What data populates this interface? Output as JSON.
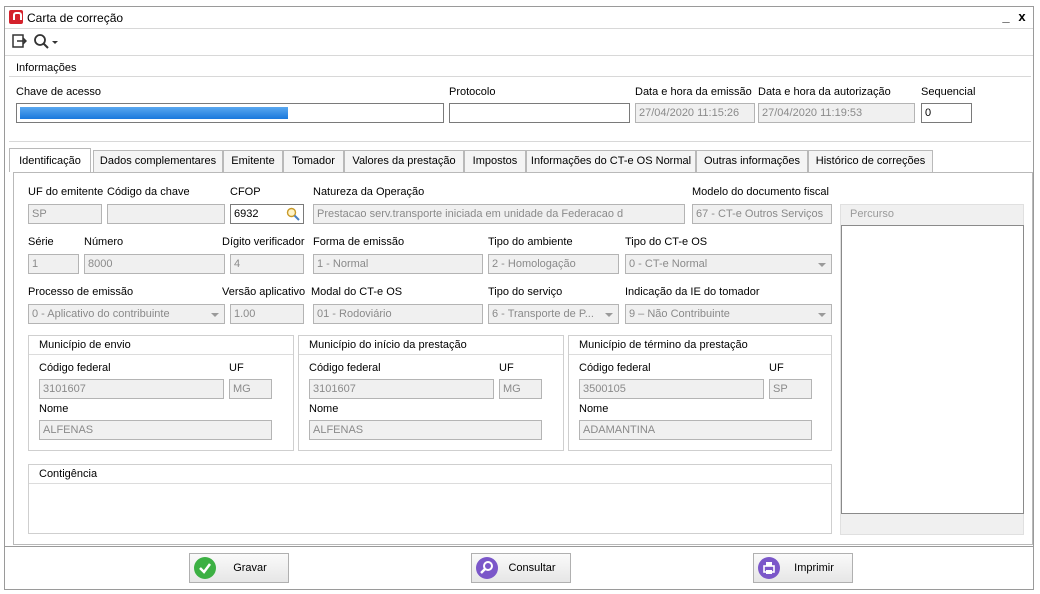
{
  "window": {
    "title": "Carta de correção",
    "minimize": "_",
    "close": "x"
  },
  "toolbar": {
    "exit_icon": "exit-icon",
    "search_icon": "magnifier-icon"
  },
  "info": {
    "section": "Informações",
    "chave_label": "Chave de acesso",
    "chave_progress": 0.63,
    "protocolo_label": "Protocolo",
    "protocolo_value": "",
    "emissao_label": "Data e hora da emissão",
    "emissao_value": "27/04/2020 11:15:26",
    "autorizacao_label": "Data e hora da autorização",
    "autorizacao_value": "27/04/2020 11:19:53",
    "sequencial_label": "Sequencial",
    "sequencial_value": "0"
  },
  "tabs": [
    "Identificação",
    "Dados complementares",
    "Emitente",
    "Tomador",
    "Valores da prestação",
    "Impostos",
    "Informações do CT-e OS Normal",
    "Outras informações",
    "Histórico de correções"
  ],
  "ident": {
    "uf_emitente_label": "UF do emitente",
    "uf_emitente": "SP",
    "codigo_chave_label": "Código da chave",
    "codigo_chave": "",
    "cfop_label": "CFOP",
    "cfop": "6932",
    "natureza_label": "Natureza da Operação",
    "natureza": "Prestacao serv.transporte iniciada em unidade da Federacao d",
    "modelo_label": "Modelo do documento fiscal",
    "modelo": "67 - CT-e Outros Serviços",
    "serie_label": "Série",
    "serie": "1",
    "numero_label": "Número",
    "numero": "8000",
    "digito_label": "Dígito verificador",
    "digito": "4",
    "forma_label": "Forma de emissão",
    "forma": "1 - Normal",
    "ambiente_label": "Tipo do ambiente",
    "ambiente": "2 - Homologação",
    "tipo_cte_label": "Tipo do CT-e OS",
    "tipo_cte": "0 - CT-e Normal",
    "processo_label": "Processo de emissão",
    "processo": "0 - Aplicativo do contribuinte",
    "versao_label": "Versão aplicativo",
    "versao": "1.00",
    "modal_label": "Modal do CT-e OS",
    "modal": "01 - Rodoviário",
    "servico_label": "Tipo do serviço",
    "servico": "6 - Transporte de P...",
    "ie_label": "Indicação da IE do tomador",
    "ie": "9 – Não Contribuinte",
    "percurso_label": "Percurso"
  },
  "mun_envio": {
    "title": "Município de envio",
    "cod_label": "Código federal",
    "cod": "3101607",
    "uf_label": "UF",
    "uf": "MG",
    "nome_label": "Nome",
    "nome": "ALFENAS"
  },
  "mun_inicio": {
    "title": "Município do início da prestação",
    "cod_label": "Código federal",
    "cod": "3101607",
    "uf_label": "UF",
    "uf": "MG",
    "nome_label": "Nome",
    "nome": "ALFENAS"
  },
  "mun_termino": {
    "title": "Município de término da prestação",
    "cod_label": "Código federal",
    "cod": "3500105",
    "uf_label": "UF",
    "uf": "SP",
    "nome_label": "Nome",
    "nome": "ADAMANTINA"
  },
  "contingencia": {
    "title": "Contigência"
  },
  "footer": {
    "gravar": "Gravar",
    "consultar": "Consultar",
    "imprimir": "Imprimir"
  },
  "colors": {
    "accent": "#1a78dc",
    "gravar_icon": "#3cb043",
    "consultar_icon": "#7b57c9",
    "imprimir_icon": "#7b57c9",
    "app_icon": "#d4212b"
  }
}
